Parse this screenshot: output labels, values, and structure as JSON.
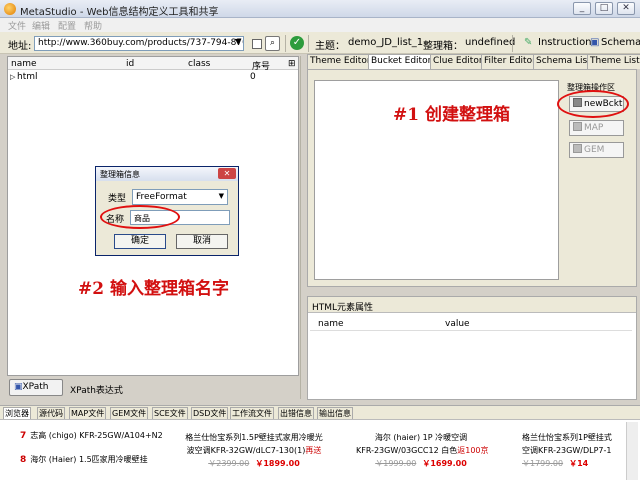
{
  "window": {
    "title": "MetaStudio - Web信息结构定义工具和共享"
  },
  "menu": {
    "items": [
      "文件",
      "编辑",
      "配置",
      "帮助"
    ]
  },
  "toolbar": {
    "address_label": "地址:",
    "address_value": "http://www.360buy.com/products/737-794-870-",
    "topic_label": "主题：",
    "topic_value": "demo_JD_list_1",
    "bucket_label": "整理箱：",
    "bucket_value": "undefined",
    "instruction_label": "Instruction",
    "schema_label": "Schema"
  },
  "dom_tree": {
    "columns": [
      "name",
      "id",
      "class",
      "序号"
    ],
    "rows": [
      {
        "name": "html",
        "seq": "0"
      }
    ]
  },
  "right_tabs": [
    "Theme Editor",
    "Bucket Editor",
    "Clue Editor",
    "Filter Editor",
    "Schema List",
    "Theme List"
  ],
  "bucket_tools": {
    "label": "整理箱操作区",
    "new_button": "newBckt",
    "map_button": "MAP",
    "gem_button": "GEM"
  },
  "html_attr": {
    "title": "HTML元素属性",
    "columns": [
      "name",
      "value"
    ]
  },
  "xpath": {
    "button": "XPath",
    "label": "XPath表达式"
  },
  "bottom_tabs": [
    "浏览器",
    "源代码",
    "MAP文件",
    "GEM文件",
    "SCE文件",
    "DSD文件",
    "工作流文件",
    "出错信息",
    "输出信息"
  ],
  "browser": {
    "rank_items": [
      {
        "num": "7",
        "text": "志高 (chigo) KFR-25GW/A104+N2"
      },
      {
        "num": "8",
        "text": "海尔 (Haier) 1.5匹家用冷暖壁挂"
      }
    ],
    "products": [
      {
        "line1": "格兰仕怡宝系列1.5P壁挂式家用冷暖光",
        "line2a": "波空调KFR-32GW/dLC7-130(1)",
        "promo": "再送",
        "old_price": "￥2399.00",
        "new_price": "￥1899.00"
      },
      {
        "line1": "海尔 (haier) 1P 冷暖空调",
        "line2a": "KFR-23GW/03GCC12 白色",
        "promo": "返100京",
        "old_price": "￥1999.00",
        "new_price": "￥1699.00"
      },
      {
        "line1": "格兰仕怡宝系列1P壁挂式",
        "line2a": "空调KFR-23GW/DLP7-1",
        "promo": "",
        "old_price": "￥1799.00",
        "new_price": "￥14"
      }
    ]
  },
  "dialog": {
    "title": "整理箱信息",
    "type_label": "类型",
    "type_value": "FreeFormat",
    "name_label": "名称",
    "name_value": "商品",
    "ok_button": "确定",
    "cancel_button": "取消"
  },
  "annotations": {
    "step1": "#1 创建整理箱",
    "step2": "#2 输入整理箱名字"
  },
  "colors": {
    "annotation_red": "#d21010",
    "price_red": "#dd0000"
  }
}
